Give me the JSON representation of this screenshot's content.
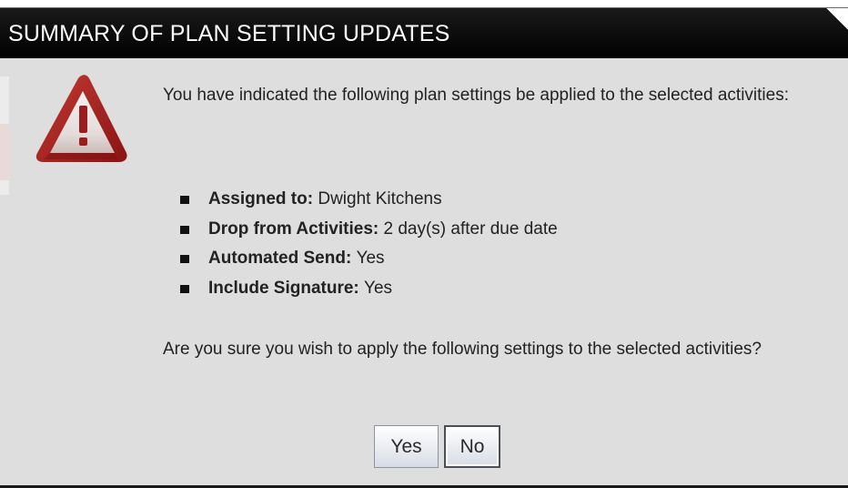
{
  "dialog": {
    "title": "SUMMARY OF PLAN SETTING UPDATES",
    "intro_text": "You have indicated the following plan settings be applied to the selected activities:",
    "settings": [
      {
        "label": "Assigned to:",
        "value": "Dwight Kitchens"
      },
      {
        "label": "Drop from Activities:",
        "value": "2 day(s) after due date"
      },
      {
        "label": "Automated Send:",
        "value": "Yes"
      },
      {
        "label": "Include Signature:",
        "value": "Yes"
      }
    ],
    "question_text": "Are you sure you wish to apply the following settings to the selected activities?",
    "yes_button": "Yes",
    "no_button": "No"
  },
  "icons": {
    "warning": "warning-triangle-icon",
    "bullet": "square-bullet-icon"
  },
  "colors": {
    "title_bar": "#000000",
    "dialog_background": "#dedede",
    "warning_red": "#a81e1e",
    "text": "#222222"
  }
}
